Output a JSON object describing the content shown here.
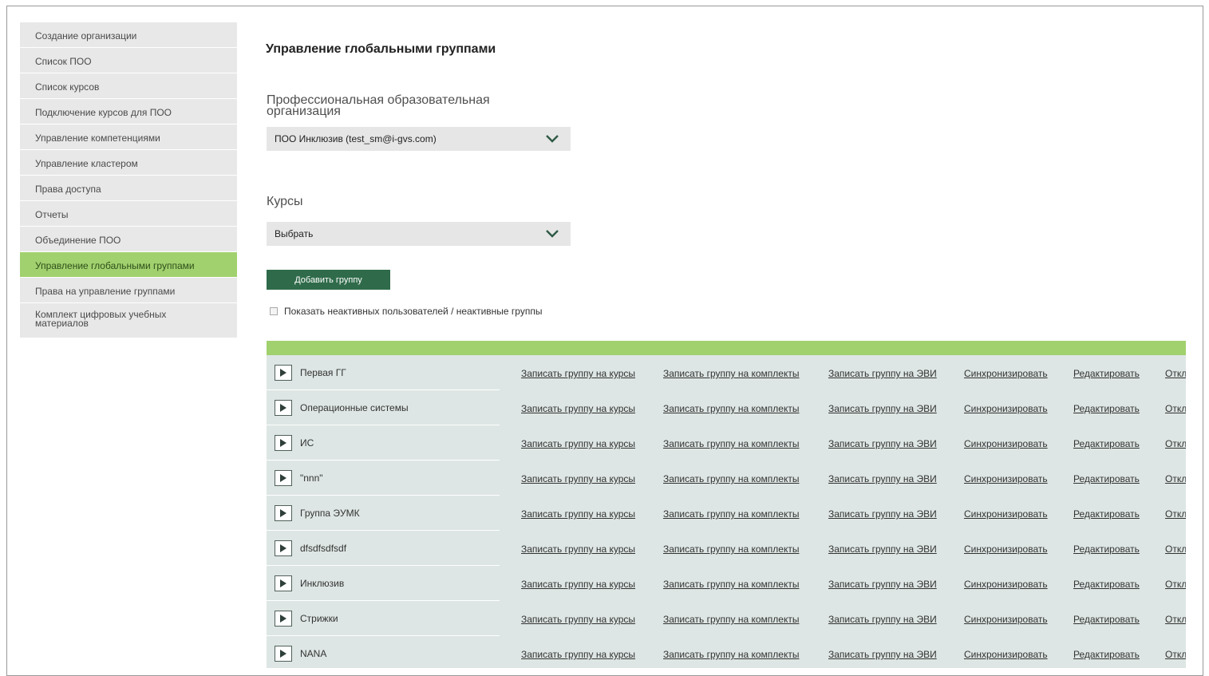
{
  "sidebar": {
    "items": [
      {
        "label": "Создание организации"
      },
      {
        "label": "Список ПОО"
      },
      {
        "label": "Список курсов"
      },
      {
        "label": "Подключение курсов для ПОО"
      },
      {
        "label": "Управление компетенциями"
      },
      {
        "label": "Управление кластером"
      },
      {
        "label": "Права доступа"
      },
      {
        "label": "Отчеты"
      },
      {
        "label": "Объединение ПОО"
      },
      {
        "label": "Управление глобальными группами",
        "active": true
      },
      {
        "label": "Права на управление группами"
      },
      {
        "label": "Комплект цифровых учебных материалов"
      }
    ]
  },
  "main": {
    "title": "Управление глобальными группами",
    "org_label": "Профессиональная образовательная организация",
    "org_value": "ПОО Инклюзив (test_sm@i-gvs.com)",
    "courses_label": "Курсы",
    "courses_value": "Выбрать",
    "add_button": "Добавить группу",
    "inactive_checkbox_label": "Показать неактивных пользователей / неактивные группы",
    "inactive_checked": false
  },
  "actions": {
    "courses": "Записать группу на курсы",
    "kits": "Записать группу на комплекты",
    "evi": "Записать группу на ЭВИ",
    "sync": "Синхронизировать",
    "edit": "Редактировать",
    "disable": "Откл"
  },
  "groups": [
    {
      "name": "Первая ГГ"
    },
    {
      "name": "Операционные системы"
    },
    {
      "name": "ИС"
    },
    {
      "name": "\"nnn\""
    },
    {
      "name": "Группа ЭУМК"
    },
    {
      "name": "dfsdfsdfsdf"
    },
    {
      "name": "Инклюзив"
    },
    {
      "name": "Стрижки"
    },
    {
      "name": "NANA"
    }
  ],
  "colors": {
    "accent_green": "#a1d16e",
    "button_green": "#2f6b4a",
    "row_bg": "#dde6e4",
    "sidebar_bg": "#e8e8e8"
  },
  "icons": {
    "select_arrow": "chevron-down-icon",
    "expand": "play-icon"
  }
}
